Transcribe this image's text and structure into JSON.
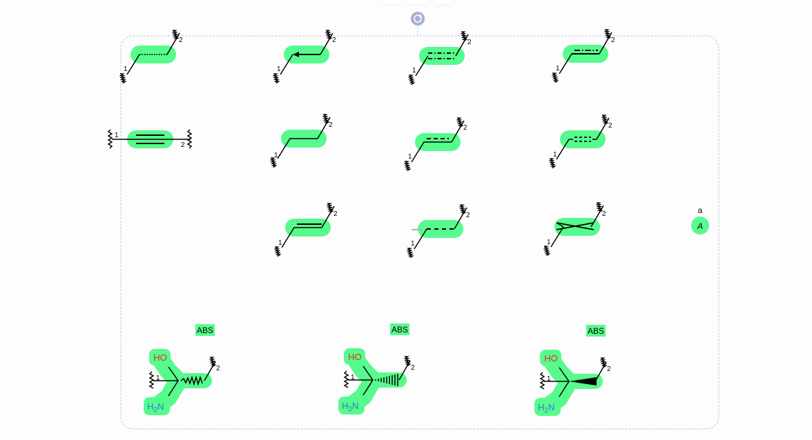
{
  "colors": {
    "highlight": "#57fa8c",
    "bond": "#000000",
    "selection_border": "#bfbfe0",
    "rotate_handle": "#a9b0d0",
    "hetero_O": "#e0301e",
    "hetero_N": "#2c7fd4",
    "background": "#fdfdfe"
  },
  "toolbar": {
    "rotate_handle_icon": "rotate-icon"
  },
  "attachment_labels": {
    "one": "1",
    "two": "2"
  },
  "stereo_flags": [
    "ABS",
    "ABS",
    "ABS"
  ],
  "atoms": {
    "hydroxyl": "HO",
    "amine_h": "H",
    "amine_sub": "2",
    "amine_n": "N"
  },
  "rgroup": {
    "label": "a",
    "atom": "A"
  }
}
